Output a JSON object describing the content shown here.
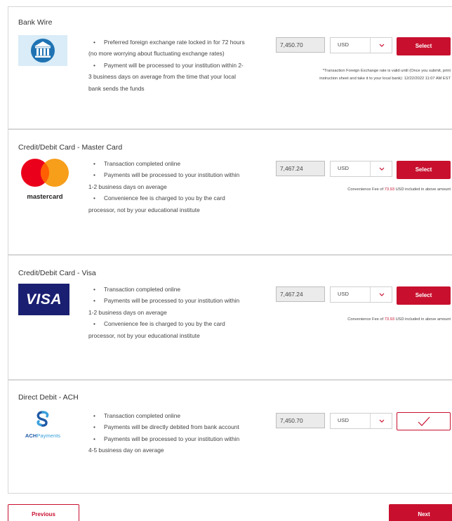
{
  "payment_options": [
    {
      "title": "Bank Wire",
      "bullets": [
        "Preferred foreign exchange rate locked in for 72 hours",
        "(no more worrying about fluctuating exchange rates)",
        "Payment will be processed to your institution within 2-",
        "3 business days on average from the time that your local",
        "bank sends the funds"
      ],
      "amount": "7,450.70",
      "currency": "USD",
      "button_label": "Select",
      "note_line1": "*Transaction Foreign Exchange rate is valid until (Once you submit, print",
      "note_line2": "instruction sheet and take it to your local bank): 12/22/2022 11:07 AM EST"
    },
    {
      "title": "Credit/Debit Card - Master Card",
      "logo_text": "mastercard",
      "bullets": [
        "Transaction completed online",
        "Payments will be processed to your institution within",
        "1-2 business days on average",
        "Convenience fee is charged to you by the card",
        "processor, not by your educational institute"
      ],
      "amount": "7,467.24",
      "currency": "USD",
      "button_label": "Select",
      "fee_prefix": "Convenience Fee of",
      "fee_amount": "73.93",
      "fee_suffix": "USD included in above amount"
    },
    {
      "title": "Credit/Debit Card - Visa",
      "logo_text": "VISA",
      "bullets": [
        "Transaction completed online",
        "Payments will be processed to your institution within",
        "1-2 business days on average",
        "Convenience fee is charged to you by the card",
        "processor, not by your educational institute"
      ],
      "amount": "7,467.24",
      "currency": "USD",
      "button_label": "Select",
      "fee_prefix": "Convenience Fee of",
      "fee_amount": "73.93",
      "fee_suffix": "USD included in above amount"
    },
    {
      "title": "Direct Debit - ACH",
      "logo_text_bold": "ACH",
      "logo_text_light": "Payments",
      "bullets": [
        "Transaction completed online",
        "Payments will be directly debited from bank account",
        "Payments will be processed to your institution within",
        "4-5 business day on average"
      ],
      "amount": "7,450.70",
      "currency": "USD",
      "selected": true
    }
  ],
  "navigation": {
    "previous_label": "Previous",
    "next_label": "Next"
  },
  "colors": {
    "accent": "#c8102e",
    "amount_bg": "#ebebeb",
    "border": "#d6d6d6"
  }
}
